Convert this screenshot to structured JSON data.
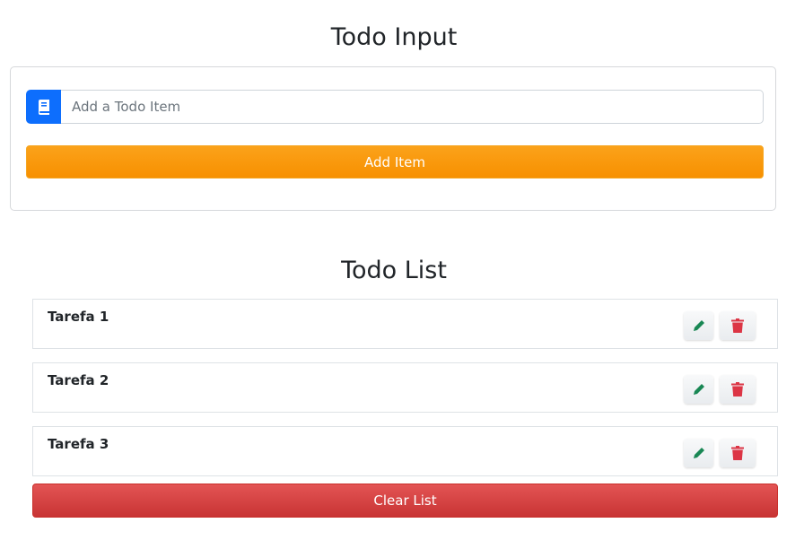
{
  "input_section": {
    "title": "Todo Input",
    "input_placeholder": "Add a Todo Item",
    "input_value": "",
    "add_button_label": "Add Item",
    "icon": "book-icon"
  },
  "list_section": {
    "title": "Todo List",
    "items": [
      {
        "text": "Tarefa 1",
        "edit_icon": "pencil-icon",
        "delete_icon": "trash-icon"
      },
      {
        "text": "Tarefa 2",
        "edit_icon": "pencil-icon",
        "delete_icon": "trash-icon"
      },
      {
        "text": "Tarefa 3",
        "edit_icon": "pencil-icon",
        "delete_icon": "trash-icon"
      }
    ],
    "clear_button_label": "Clear List"
  },
  "colors": {
    "primary": "#0d6efd",
    "warning": "#f79000",
    "danger": "#dc3545",
    "success": "#198754"
  }
}
